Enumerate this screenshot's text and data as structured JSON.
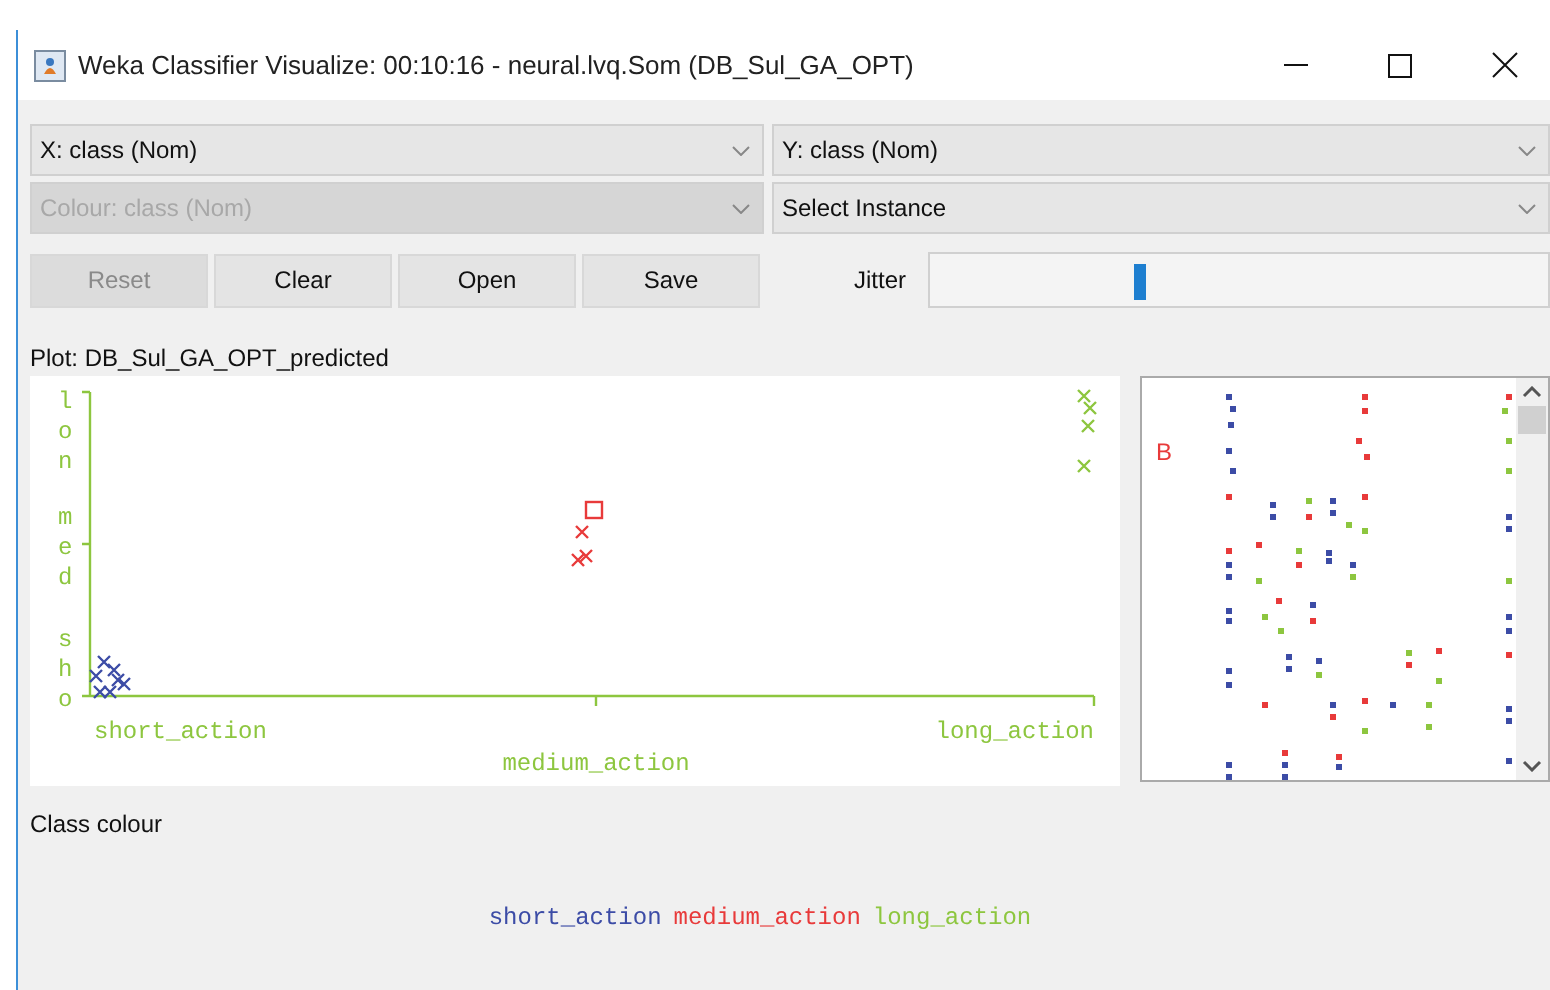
{
  "window": {
    "title": "Weka Classifier Visualize: 00:10:16 - neural.lvq.Som (DB_Sul_GA_OPT)"
  },
  "selectors": [
    {
      "label": "X: class (Nom)",
      "disabled": false
    },
    {
      "label": "Y: class (Nom)",
      "disabled": false
    },
    {
      "label": "Colour: class (Nom)",
      "disabled": true
    },
    {
      "label": "Select Instance",
      "disabled": false
    }
  ],
  "buttons": [
    {
      "label": "Reset",
      "disabled": true
    },
    {
      "label": "Clear",
      "disabled": false
    },
    {
      "label": "Open",
      "disabled": false
    },
    {
      "label": "Save",
      "disabled": false
    }
  ],
  "jitter": {
    "label": "Jitter",
    "level": 0.34
  },
  "plot": {
    "title": "Plot: DB_Sul_GA_OPT_predicted",
    "x_labels": [
      "short_action",
      "medium_action",
      "long_action"
    ],
    "y_labels": [
      "lon",
      "med",
      "sho"
    ]
  },
  "matrix": {
    "label": "B"
  },
  "class_colour": {
    "title": "Class colour",
    "classes": [
      {
        "name": "short_action",
        "color": "#3c4ca6"
      },
      {
        "name": "medium_action",
        "color": "#e83a3a"
      },
      {
        "name": "long_action",
        "color": "#8dc63f"
      }
    ]
  }
}
